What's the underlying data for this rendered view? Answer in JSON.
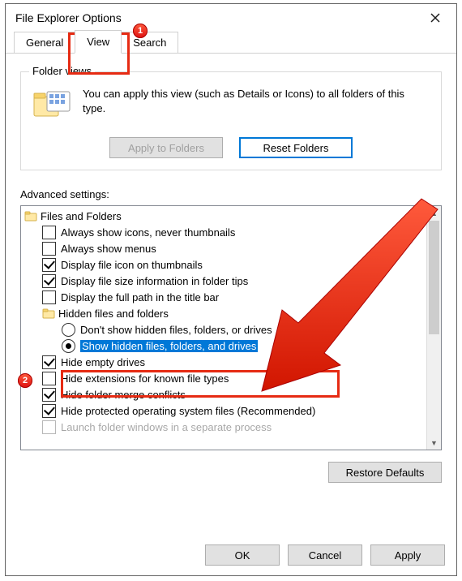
{
  "window": {
    "title": "File Explorer Options"
  },
  "tabs": {
    "general": "General",
    "view": "View",
    "search": "Search",
    "active": "view"
  },
  "folder_views": {
    "legend": "Folder views",
    "text": "You can apply this view (such as Details or Icons) to all folders of this type.",
    "apply_btn": "Apply to Folders",
    "reset_btn": "Reset Folders"
  },
  "advanced": {
    "label": "Advanced settings:",
    "root": "Files and Folders",
    "items": [
      {
        "kind": "check",
        "checked": false,
        "label": "Always show icons, never thumbnails"
      },
      {
        "kind": "check",
        "checked": false,
        "label": "Always show menus"
      },
      {
        "kind": "check",
        "checked": true,
        "label": "Display file icon on thumbnails"
      },
      {
        "kind": "check",
        "checked": true,
        "label": "Display file size information in folder tips"
      },
      {
        "kind": "check",
        "checked": false,
        "label": "Display the full path in the title bar"
      }
    ],
    "hidden_group": "Hidden files and folders",
    "hidden_options": [
      {
        "selected": false,
        "label": "Don't show hidden files, folders, or drives"
      },
      {
        "selected": true,
        "label": "Show hidden files, folders, and drives"
      }
    ],
    "items_after": [
      {
        "kind": "check",
        "checked": true,
        "label": "Hide empty drives"
      },
      {
        "kind": "check",
        "checked": false,
        "label": "Hide extensions for known file types"
      },
      {
        "kind": "check",
        "checked": true,
        "label": "Hide folder merge conflicts"
      },
      {
        "kind": "check",
        "checked": true,
        "label": "Hide protected operating system files (Recommended)"
      },
      {
        "kind": "check",
        "checked": false,
        "label": "Launch folder windows in a separate process"
      }
    ]
  },
  "restore_btn": "Restore Defaults",
  "dialog": {
    "ok": "OK",
    "cancel": "Cancel",
    "apply": "Apply"
  },
  "callouts": {
    "b1": "1",
    "b2": "2"
  }
}
